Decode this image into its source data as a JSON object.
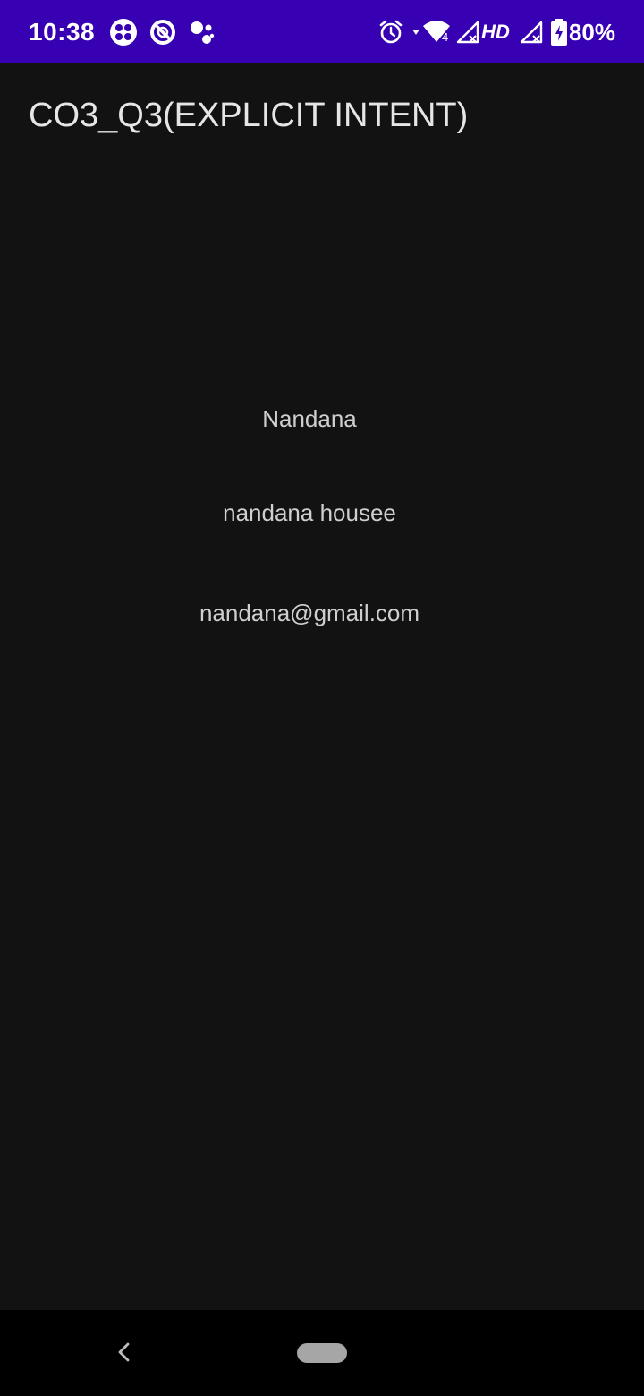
{
  "status_bar": {
    "time": "10:38",
    "network_type": "4",
    "hd_label": "HD",
    "battery_percent": "80%",
    "background_color": "#3700b3",
    "left_icons": [
      "app-notification-icon",
      "data-saver-icon",
      "assistant-icon"
    ],
    "right_icons": [
      "alarm-icon",
      "wifi-icon",
      "signal-icon",
      "battery-charging-icon"
    ]
  },
  "app_bar": {
    "title": "CO3_Q3(EXPLICIT INTENT)"
  },
  "content": {
    "name": "Nandana",
    "address": "nandana housee",
    "email": "nandana@gmail.com"
  },
  "nav_bar": {
    "buttons": [
      "back-icon",
      "home-pill"
    ]
  }
}
